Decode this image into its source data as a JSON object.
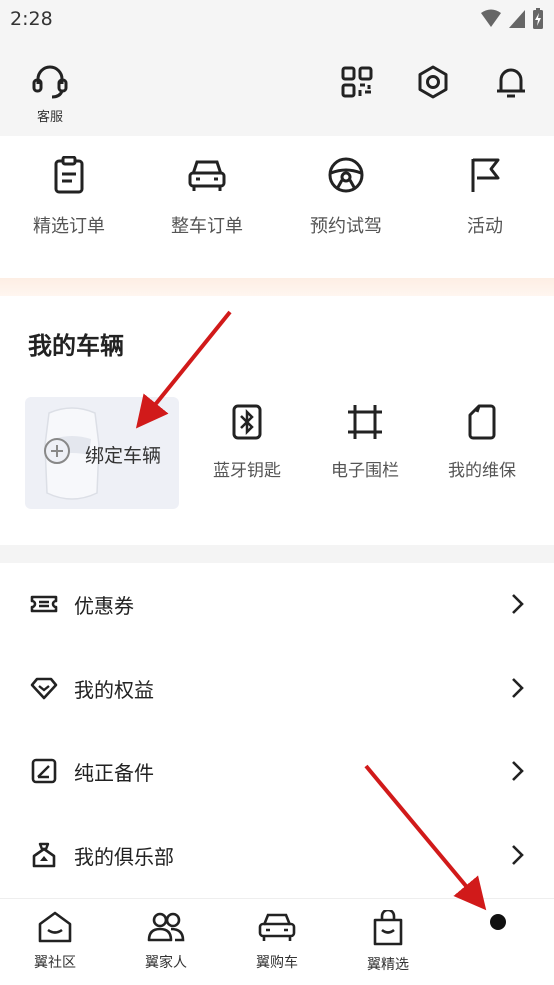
{
  "status": {
    "time": "2:28"
  },
  "header": {
    "customer_service_label": "客服",
    "icons": [
      "qr-code-icon",
      "settings-icon",
      "bell-icon"
    ]
  },
  "orders": [
    {
      "label": "精选订单",
      "icon": "clipboard-icon"
    },
    {
      "label": "整车订单",
      "icon": "car-icon"
    },
    {
      "label": "预约试驾",
      "icon": "steering-wheel-icon"
    },
    {
      "label": "活动",
      "icon": "flag-icon"
    }
  ],
  "vehicle": {
    "title": "我的车辆",
    "bind_label": "绑定车辆",
    "items": [
      {
        "label": "蓝牙钥匙",
        "icon": "bluetooth-key-icon"
      },
      {
        "label": "电子围栏",
        "icon": "fence-icon"
      },
      {
        "label": "我的维保",
        "icon": "maintenance-icon"
      }
    ]
  },
  "menu": [
    {
      "label": "优惠券",
      "icon": "ticket-icon"
    },
    {
      "label": "我的权益",
      "icon": "diamond-icon"
    },
    {
      "label": "纯正备件",
      "icon": "parts-icon"
    },
    {
      "label": "我的俱乐部",
      "icon": "club-icon"
    }
  ],
  "nav": [
    {
      "label": "翼社区",
      "icon": "community-icon"
    },
    {
      "label": "翼家人",
      "icon": "people-icon"
    },
    {
      "label": "翼购车",
      "icon": "car-buy-icon"
    },
    {
      "label": "翼精选",
      "icon": "shopping-bag-icon"
    }
  ],
  "colors": {
    "annotation_arrow": "#d11a1a",
    "accent_strip": "#fdeee4"
  }
}
